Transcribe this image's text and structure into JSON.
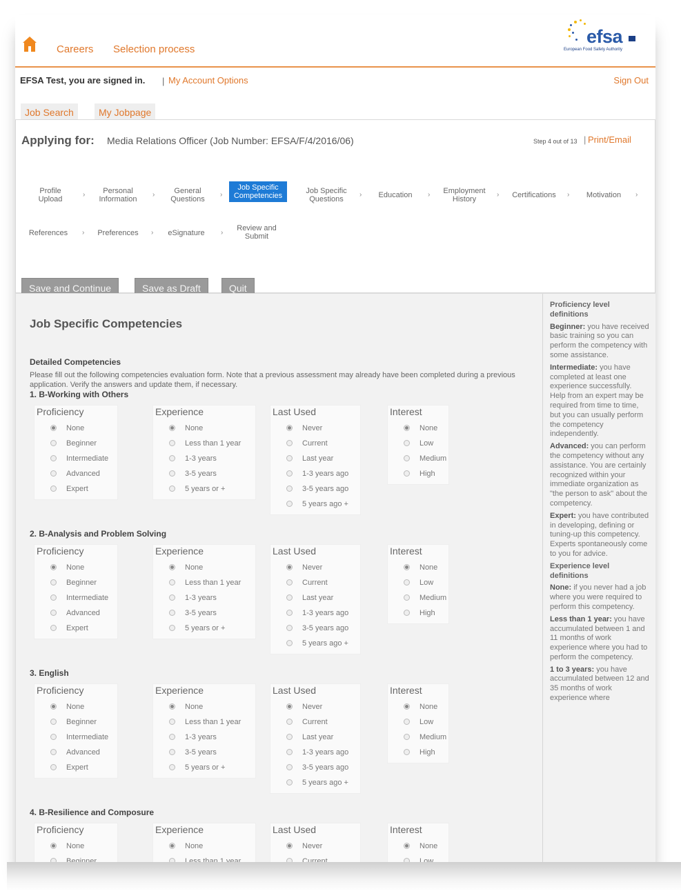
{
  "header": {
    "home_icon": "home-icon",
    "nav": [
      "Careers",
      "Selection process"
    ],
    "logo": {
      "text": "efsa",
      "subtitle": "European Food Safety Authority"
    }
  },
  "account": {
    "signed_in": "EFSA Test, you are signed in.",
    "separator": "|",
    "my_account": "My Account Options",
    "sign_out": "Sign Out"
  },
  "tabs": [
    "Job Search",
    "My Jobpage"
  ],
  "application": {
    "applying_label": "Applying for:",
    "job": "Media Relations Officer (Job Number: EFSA/F/4/2016/06)",
    "step_of": "Step 4 out of 13",
    "separator": "|",
    "print": "Print/Email",
    "steps_row1": [
      {
        "l1": "Profile",
        "l2": "Upload"
      },
      {
        "l1": "Personal",
        "l2": "Information"
      },
      {
        "l1": "General",
        "l2": "Questions"
      },
      {
        "l1": "Job Specific",
        "l2": "Competencies"
      },
      {
        "l1": "Job Specific",
        "l2": "Questions"
      },
      {
        "l1": "Education",
        "l2": ""
      },
      {
        "l1": "Employment",
        "l2": "History"
      },
      {
        "l1": "Certifications",
        "l2": ""
      },
      {
        "l1": "Motivation",
        "l2": ""
      }
    ],
    "steps_row2": [
      {
        "l1": "References",
        "l2": ""
      },
      {
        "l1": "Preferences",
        "l2": ""
      },
      {
        "l1": "eSignature",
        "l2": ""
      },
      {
        "l1": "Review and",
        "l2": "Submit"
      }
    ],
    "buttons": {
      "save_continue": "Save and Continue",
      "save_draft": "Save as Draft",
      "quit": "Quit"
    }
  },
  "main": {
    "title": "Job Specific Competencies",
    "detailed_heading": "Detailed Competencies",
    "instructions": "Please fill out the following competencies evaluation form. Note that a previous assessment may already have been completed during a previous application. Verify the answers and update them, if necessary.",
    "columns": {
      "proficiency": {
        "label": "Proficiency",
        "options": [
          "None",
          "Beginner",
          "Intermediate",
          "Advanced",
          "Expert"
        ]
      },
      "experience": {
        "label": "Experience",
        "options": [
          "None",
          "Less than 1 year",
          "1-3 years",
          "3-5 years",
          "5 years or +"
        ]
      },
      "last_used": {
        "label": "Last Used",
        "options": [
          "Never",
          "Current",
          "Last year",
          "1-3 years ago",
          "3-5 years ago",
          "5 years ago +"
        ]
      },
      "interest": {
        "label": "Interest",
        "options": [
          "None",
          "Low",
          "Medium",
          "High"
        ]
      }
    },
    "competencies": [
      "1. B-Working with Others",
      "2. B-Analysis and Problem Solving",
      "3. English",
      "4. B-Resilience and Composure"
    ]
  },
  "sidebar": {
    "proficiency_heading": "Proficiency level definitions",
    "proficiency_defs": [
      {
        "term": "Beginner:",
        "text": " you have received basic training so you can perform the competency with some assistance."
      },
      {
        "term": "Intermediate:",
        "text": " you have completed at least one experience successfully. Help from an expert may be required from time to time, but you can usually perform the competency independently."
      },
      {
        "term": "Advanced:",
        "text": " you can perform the competency without any assistance. You are certainly recognized within your immediate organization as \"the person to ask\" about the competency."
      },
      {
        "term": "Expert:",
        "text": " you have contributed in developing, defining or tuning-up this competency. Experts spontaneously come to you for advice."
      }
    ],
    "experience_heading": "Experience level definitions",
    "experience_defs": [
      {
        "term": "None:",
        "text": " if you never had a job where you were required to perform this competency."
      },
      {
        "term": "Less than 1 year:",
        "text": " you have accumulated between 1 and 11 months of work experience where you had to perform the competency."
      },
      {
        "term": "1 to 3 years:",
        "text": " you have accumulated between 12 and 35 months of work experience where"
      }
    ]
  }
}
